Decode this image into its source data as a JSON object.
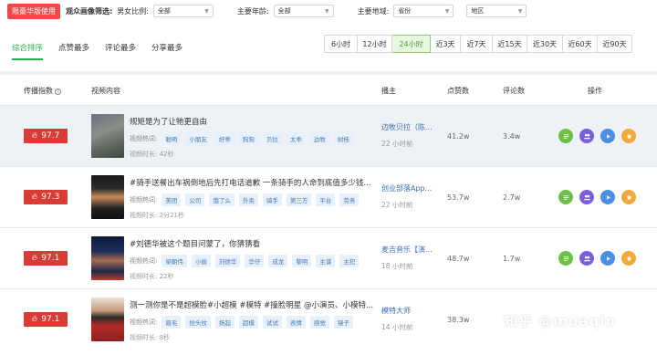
{
  "filter": {
    "vip_badge": "限豪华版使用",
    "label_audience": "观众画像筛选:",
    "label_gender": "男女比例:",
    "gender_value": "全部",
    "label_age": "主要年龄:",
    "age_value": "全部",
    "label_region": "主要地域:",
    "province_value": "省份",
    "area_value": "地区"
  },
  "main_tabs": [
    {
      "label": "综合排序",
      "active": true
    },
    {
      "label": "点赞最多",
      "active": false
    },
    {
      "label": "评论最多",
      "active": false
    },
    {
      "label": "分享最多",
      "active": false
    }
  ],
  "time_tabs": [
    {
      "label": "6小时",
      "active": false
    },
    {
      "label": "12小时",
      "active": false
    },
    {
      "label": "24小时",
      "active": true
    },
    {
      "label": "近3天",
      "active": false
    },
    {
      "label": "近7天",
      "active": false
    },
    {
      "label": "近15天",
      "active": false
    },
    {
      "label": "近30天",
      "active": false
    },
    {
      "label": "近60天",
      "active": false
    },
    {
      "label": "近90天",
      "active": false
    }
  ],
  "columns": {
    "index": "传播指数",
    "content": "视频内容",
    "author": "播主",
    "likes": "点赞数",
    "comments": "评论数",
    "actions": "操作"
  },
  "labels": {
    "keywords": "视频热词:",
    "duration": "视频时长:"
  },
  "rows": [
    {
      "score": "97.7",
      "title": "规矩是为了让牠更自由",
      "keywords": [
        "聪明",
        "小朋友",
        "好乖",
        "狗狗",
        "贝拉",
        "太乖",
        "边牧",
        "树桂"
      ],
      "duration": "42秒",
      "author": "边牧贝拉（陈...",
      "time": "22 小时前",
      "likes": "41.2w",
      "comments": "3.4w"
    },
    {
      "score": "97.3",
      "title": "#骑手送餐出车祸倒地后先打电话道歉 一条骑手的人命到底值多少钱...",
      "keywords": [
        "美团",
        "公司",
        "饿了么",
        "外卖",
        "骑手",
        "第三方",
        "平台",
        "劳务"
      ],
      "duration": "2分21秒",
      "author": "创业部落App...",
      "time": "22 小时前",
      "likes": "53.7w",
      "comments": "2.7w"
    },
    {
      "score": "97.1",
      "title": "#刘德华被这个题目问蒙了，你猜猜看",
      "keywords": [
        "梁朝伟",
        "小偷",
        "刘德华",
        "华仔",
        "成龙",
        "黎明",
        "主谋",
        "主犯"
      ],
      "duration": "22秒",
      "author": "麦吉音乐【演...",
      "time": "18 小时前",
      "likes": "48.7w",
      "comments": "1.7w"
    },
    {
      "score": "97.1",
      "title": "测一测你是不是超模脸#小超模 #模特 #撞脸明星 @小演员、小模特...",
      "keywords": [
        "眉毛",
        "抬头纹",
        "扬起",
        "超模",
        "试试",
        "表情",
        "感觉",
        "镜子"
      ],
      "duration": "8秒",
      "author": "模特大师",
      "time": "14 小时前",
      "likes": "38.3w",
      "comments": ""
    }
  ],
  "action_icons": [
    "detail-icon",
    "audience-icon",
    "play-icon",
    "favorite-icon"
  ],
  "action_colors": [
    "#6cc04a",
    "#7b5fd6",
    "#4a8fe2",
    "#f0a93a"
  ],
  "watermark": "知乎 @muaqin"
}
